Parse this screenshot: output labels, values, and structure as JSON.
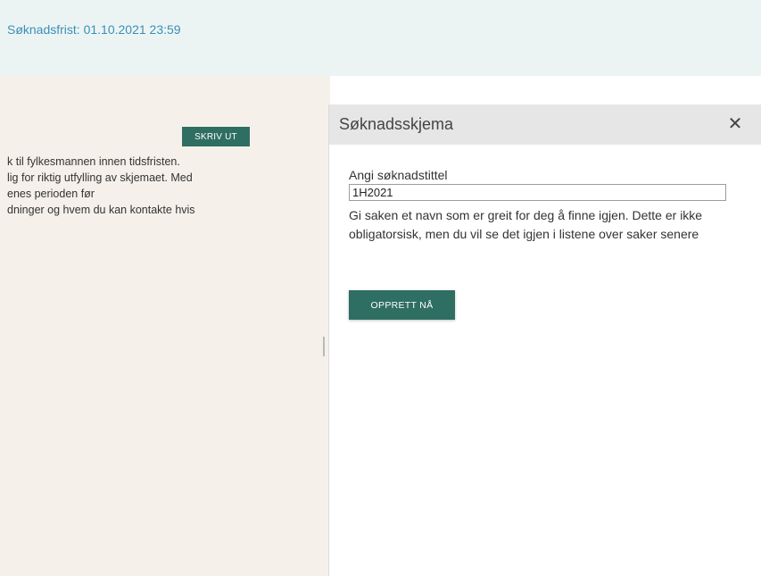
{
  "banner": {
    "deadline": "Søknadsfrist: 01.10.2021 23:59"
  },
  "left_panel": {
    "print_label": "SKRIV UT",
    "intro_lines": [
      "k til fylkesmannen innen tidsfristen.",
      "lig for riktig utfylling av skjemaet. Med",
      "enes perioden før",
      "dninger og hvem du kan kontakte hvis"
    ]
  },
  "side_panel": {
    "title": "Søknadsskjema",
    "close_symbol": "✕",
    "field_label": "Angi søknadstittel",
    "input_value": "1H2021",
    "help_text": "Gi saken et navn som er greit for deg å finne igjen. Dette er ikke obligatorsisk, men du vil se det igjen i listene over saker senere",
    "create_label": "OPPRETT NÅ"
  },
  "colors": {
    "accent": "#2f6e63",
    "link": "#3a8fb7",
    "banner_bg": "#ecf4f3",
    "page_bg": "#f5f1ea",
    "header_bg": "#e6e6e6"
  },
  "icons": {
    "close": "close-icon"
  }
}
